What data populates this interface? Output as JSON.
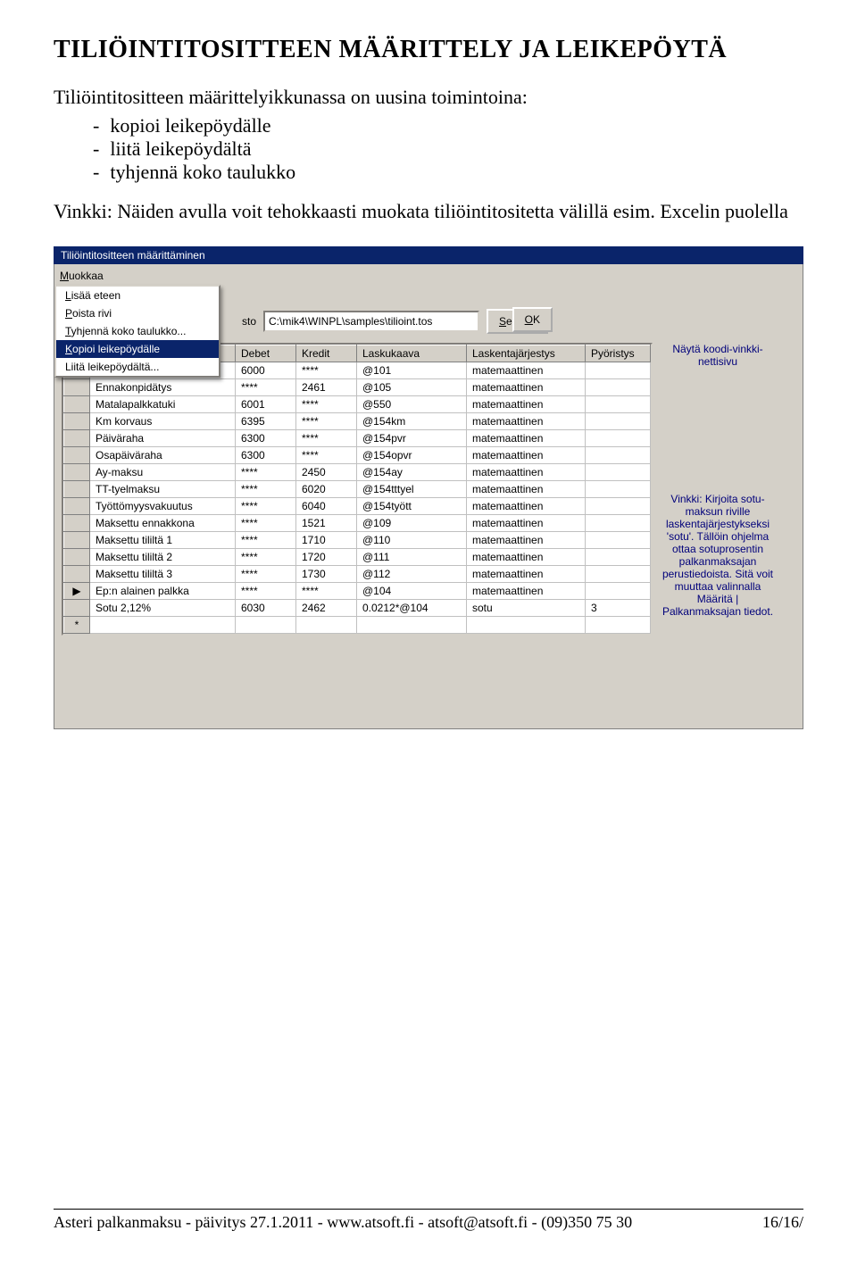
{
  "doc": {
    "heading": "TILIÖINTITOSITTEEN MÄÄRITTELY JA LEIKEPÖYTÄ",
    "intro": "Tiliöintitositteen määrittelyikkunassa on uusina toimintoina:",
    "bullets": [
      "kopioi leikepöydälle",
      "liitä leikepöydältä",
      "tyhjennä koko taulukko"
    ],
    "hint": "Vinkki: Näiden avulla voit tehokkaasti muokata tiliöintitositetta välillä esim. Excelin puolella"
  },
  "win": {
    "title": "Tiliöintitositteen määrittäminen",
    "menu": "Muokkaa",
    "dropdown": {
      "items": [
        {
          "label": "Lisää eteen",
          "ul": "L"
        },
        {
          "label": "Poista rivi",
          "ul": "P"
        },
        {
          "label": "Tyhjennä koko taulukko...",
          "ul": "T"
        },
        {
          "label": "Kopioi leikepöydälle",
          "ul": "K",
          "selected": true
        },
        {
          "label": "Liitä leikepöydältä...",
          "ul": ""
        }
      ]
    },
    "pathlabel": "sto",
    "path": "C:\\mik4\\WINPL\\samples\\tilioint.tos",
    "browse": "Selaa...",
    "ok": "OK",
    "headers": [
      "",
      "Debet",
      "Kredit",
      "Laskukaava",
      "Laskentajärjestys",
      "Pyöristys"
    ],
    "rows": [
      {
        "m": "",
        "c0": "",
        "c1": "6000",
        "c2": "****",
        "c3": "@101",
        "c4": "matemaattinen",
        "c5": ""
      },
      {
        "m": "",
        "c0": "Ennakonpidätys",
        "c1": "****",
        "c2": "2461",
        "c3": "@105",
        "c4": "matemaattinen",
        "c5": ""
      },
      {
        "m": "",
        "c0": "Matalapalkkatuki",
        "c1": "6001",
        "c2": "****",
        "c3": "@550",
        "c4": "matemaattinen",
        "c5": ""
      },
      {
        "m": "",
        "c0": "Km korvaus",
        "c1": "6395",
        "c2": "****",
        "c3": "@154km",
        "c4": "matemaattinen",
        "c5": ""
      },
      {
        "m": "",
        "c0": "Päiväraha",
        "c1": "6300",
        "c2": "****",
        "c3": "@154pvr",
        "c4": "matemaattinen",
        "c5": ""
      },
      {
        "m": "",
        "c0": "Osapäiväraha",
        "c1": "6300",
        "c2": "****",
        "c3": "@154opvr",
        "c4": "matemaattinen",
        "c5": ""
      },
      {
        "m": "",
        "c0": "Ay-maksu",
        "c1": "****",
        "c2": "2450",
        "c3": "@154ay",
        "c4": "matemaattinen",
        "c5": ""
      },
      {
        "m": "",
        "c0": "TT-tyelmaksu",
        "c1": "****",
        "c2": "6020",
        "c3": "@154tttyel",
        "c4": "matemaattinen",
        "c5": ""
      },
      {
        "m": "",
        "c0": "Työttömyysvakuutus",
        "c1": "****",
        "c2": "6040",
        "c3": "@154tyött",
        "c4": "matemaattinen",
        "c5": ""
      },
      {
        "m": "",
        "c0": "Maksettu ennakkona",
        "c1": "****",
        "c2": "1521",
        "c3": "@109",
        "c4": "matemaattinen",
        "c5": ""
      },
      {
        "m": "",
        "c0": "Maksettu tililtä 1",
        "c1": "****",
        "c2": "1710",
        "c3": "@110",
        "c4": "matemaattinen",
        "c5": ""
      },
      {
        "m": "",
        "c0": "Maksettu tililtä 2",
        "c1": "****",
        "c2": "1720",
        "c3": "@111",
        "c4": "matemaattinen",
        "c5": ""
      },
      {
        "m": "",
        "c0": "Maksettu tililtä 3",
        "c1": "****",
        "c2": "1730",
        "c3": "@112",
        "c4": "matemaattinen",
        "c5": ""
      },
      {
        "m": "▶",
        "c0": "Ep:n alainen palkka",
        "c1": "****",
        "c2": "****",
        "c3": "@104",
        "c4": "matemaattinen",
        "c5": ""
      },
      {
        "m": "",
        "c0": "Sotu 2,12%",
        "c1": "6030",
        "c2": "2462",
        "c3": "0.0212*@104",
        "c4": "sotu",
        "c5": "3"
      },
      {
        "m": "*",
        "c0": "",
        "c1": "",
        "c2": "",
        "c3": "",
        "c4": "",
        "c5": ""
      }
    ],
    "side": {
      "link": "Näytä koodi-vinkki-nettisivu",
      "tip": "Vinkki: Kirjoita sotu-maksun riville laskentajärjestykseksi 'sotu'. Tällöin ohjelma ottaa sotuprosentin palkanmaksajan perustiedoista. Sitä voit muuttaa valinnalla Määritä | Palkanmaksajan tiedot."
    }
  },
  "footer": {
    "left": "Asteri palkanmaksu - päivitys 27.1.2011 - www.atsoft.fi - atsoft@atsoft.fi - (09)350 75 30",
    "right": "16/16/"
  }
}
